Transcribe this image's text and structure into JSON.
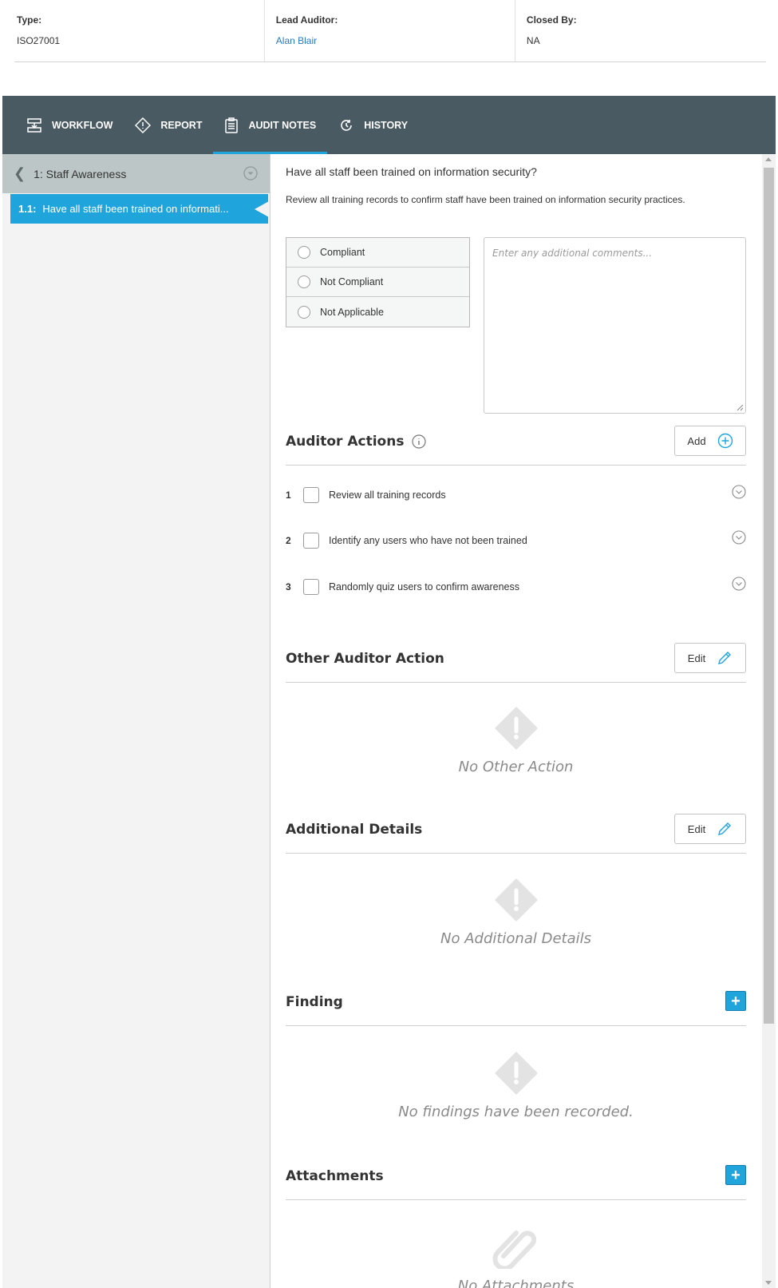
{
  "header": {
    "type_label": "Type:",
    "type_value": "ISO27001",
    "lead_auditor_label": "Lead Auditor:",
    "lead_auditor_value": "Alan Blair",
    "closed_by_label": "Closed By:",
    "closed_by_value": "NA"
  },
  "nav": {
    "tabs": [
      {
        "label": "WORKFLOW",
        "icon": "workflow-icon",
        "active": false
      },
      {
        "label": "REPORT",
        "icon": "report-diamond-icon",
        "active": false
      },
      {
        "label": "AUDIT NOTES",
        "icon": "clipboard-icon",
        "active": true
      },
      {
        "label": "HISTORY",
        "icon": "history-icon",
        "active": false
      }
    ],
    "active_color": "#1fa5dc",
    "background": "#4a5a63"
  },
  "sidebar": {
    "section_label": "1: Staff Awareness",
    "active_item_num": "1.1:",
    "active_item_label": "Have all staff been trained on informati..."
  },
  "question": {
    "title": "Have all staff been trained on information security?",
    "description": "Review all training records to confirm staff have been trained on information security practices.",
    "options": [
      "Compliant",
      "Not Compliant",
      "Not Applicable"
    ],
    "comments_placeholder": "Enter any additional comments..."
  },
  "auditor_actions": {
    "title": "Auditor Actions",
    "add_label": "Add",
    "items": [
      {
        "num": "1",
        "text": "Review all training records"
      },
      {
        "num": "2",
        "text": "Identify any users who have not been trained"
      },
      {
        "num": "3",
        "text": "Randomly quiz users to confirm awareness"
      }
    ]
  },
  "other_action": {
    "title": "Other Auditor Action",
    "edit_label": "Edit",
    "empty_msg": "No Other Action"
  },
  "additional_details": {
    "title": "Additional Details",
    "edit_label": "Edit",
    "empty_msg": "No Additional Details"
  },
  "finding": {
    "title": "Finding",
    "add_label": "+",
    "empty_msg": "No findings have been recorded."
  },
  "attachments": {
    "title": "Attachments",
    "add_label": "+",
    "empty_msg": "No Attachments"
  }
}
